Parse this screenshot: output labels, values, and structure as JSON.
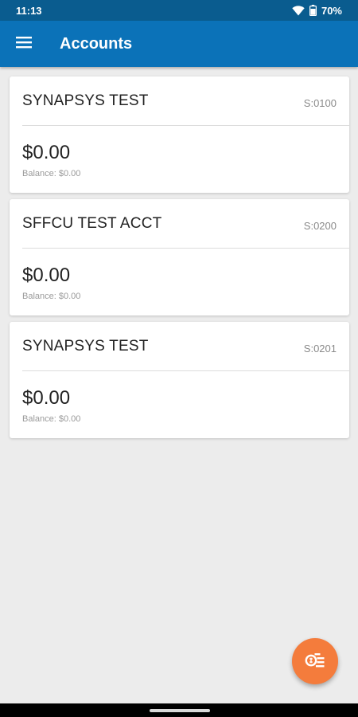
{
  "status_bar": {
    "time": "11:13",
    "battery": "70%"
  },
  "app_bar": {
    "title": "Accounts"
  },
  "accounts": [
    {
      "name": "SYNAPSYS TEST",
      "id": "S:0100",
      "amount": "$0.00",
      "balance": "Balance: $0.00"
    },
    {
      "name": "SFFCU TEST ACCT",
      "id": "S:0200",
      "amount": "$0.00",
      "balance": "Balance: $0.00"
    },
    {
      "name": "SYNAPSYS TEST",
      "id": "S:0201",
      "amount": "$0.00",
      "balance": "Balance: $0.00"
    }
  ],
  "icons": {
    "menu": "menu-icon",
    "wifi": "wifi-icon",
    "battery": "battery-icon",
    "fab": "quick-pay-icon"
  },
  "colors": {
    "status_bar": "#0a5c8f",
    "app_bar": "#0b72b8",
    "fab": "#f47c3c",
    "background": "#ececec"
  }
}
